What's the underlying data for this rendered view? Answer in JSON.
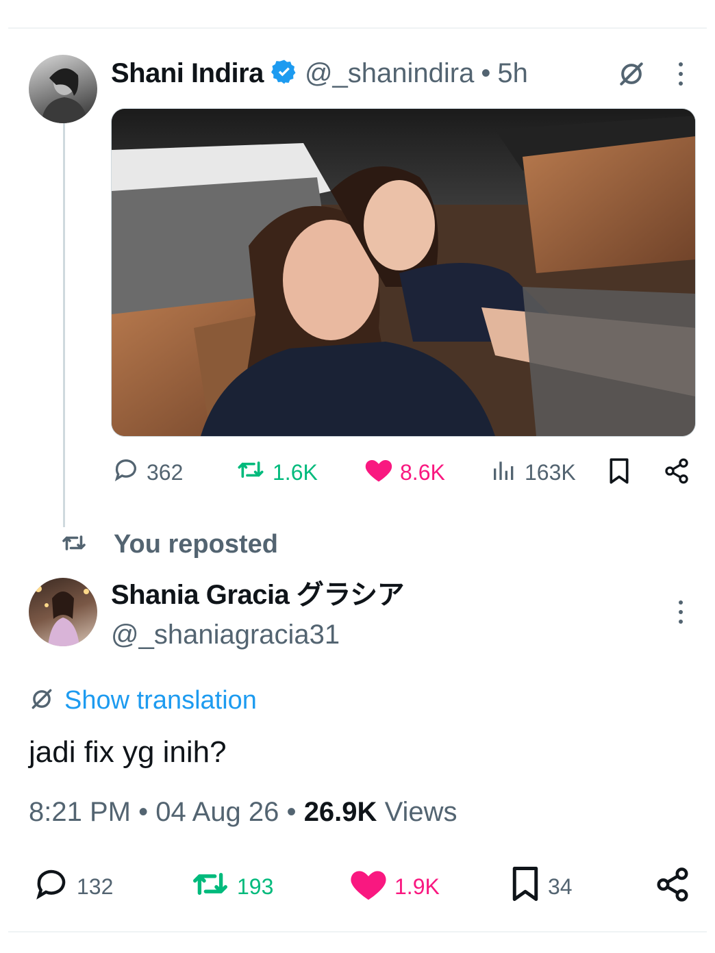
{
  "quoted_post": {
    "author_name": "Shani Indira",
    "author_handle": "@_shanindira",
    "time_ago": "5h",
    "stats": {
      "replies": "362",
      "reposts": "1.6K",
      "likes": "8.6K",
      "views": "163K"
    }
  },
  "repost_banner": {
    "label": "You reposted"
  },
  "main_post": {
    "author_name": "Shania Gracia グラシア",
    "author_handle": "@_shaniagracia31",
    "show_translation": "Show translation",
    "text": "jadi fix yg inih?",
    "time": "8:21 PM",
    "date": "04 Aug 26",
    "views_count": "26.9K",
    "views_label": "Views",
    "separator": "•",
    "stats": {
      "replies": "132",
      "reposts": "193",
      "likes": "1.9K",
      "bookmarks": "34"
    }
  },
  "colors": {
    "verified": "#1d9bf0",
    "repost_green": "#00ba7c",
    "like_pink": "#f91880",
    "link_blue": "#1d9bf0",
    "muted": "#536471"
  },
  "icons": [
    "verified-icon",
    "grok-icon",
    "more-icon",
    "reply-icon",
    "repost-icon",
    "like-icon",
    "views-icon",
    "bookmark-icon",
    "share-icon",
    "translate-icon"
  ]
}
